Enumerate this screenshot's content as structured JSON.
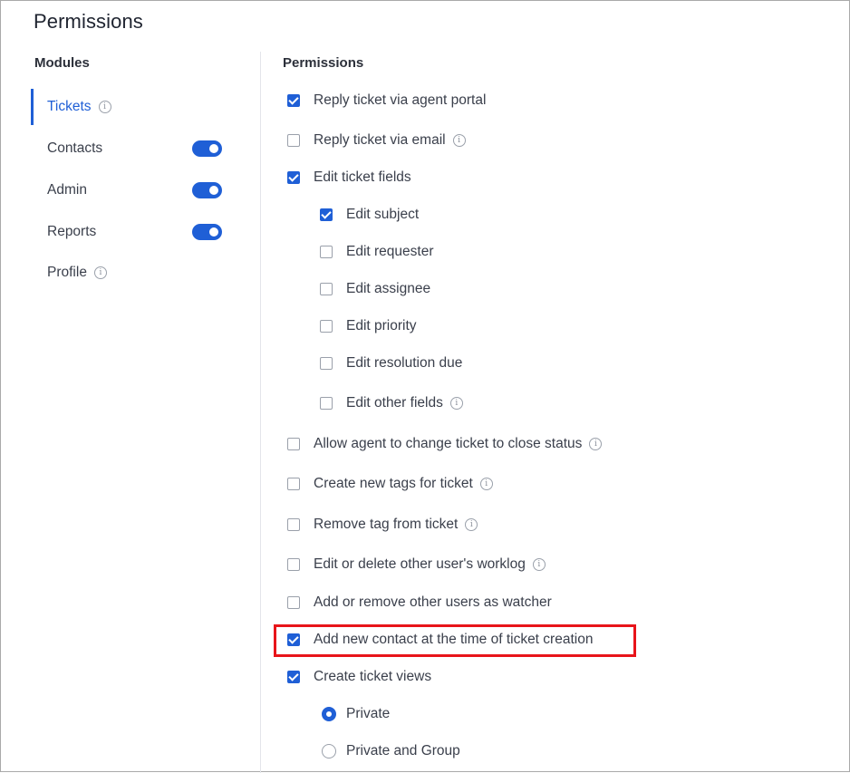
{
  "page": {
    "title": "Permissions"
  },
  "modules": {
    "heading": "Modules",
    "items": [
      {
        "label": "Tickets",
        "active": true,
        "has_info": true,
        "toggle": null
      },
      {
        "label": "Contacts",
        "active": false,
        "has_info": false,
        "toggle": "on"
      },
      {
        "label": "Admin",
        "active": false,
        "has_info": false,
        "toggle": "on"
      },
      {
        "label": "Reports",
        "active": false,
        "has_info": false,
        "toggle": "on"
      },
      {
        "label": "Profile",
        "active": false,
        "has_info": true,
        "toggle": null
      }
    ]
  },
  "permissions": {
    "heading": "Permissions",
    "items": [
      {
        "label": "Reply ticket via agent portal",
        "checked": true,
        "level": 0,
        "info": false
      },
      {
        "label": "Reply ticket via email",
        "checked": false,
        "level": 0,
        "info": true
      },
      {
        "label": "Edit ticket fields",
        "checked": true,
        "level": 0,
        "info": false
      },
      {
        "label": "Edit subject",
        "checked": true,
        "level": 1,
        "info": false
      },
      {
        "label": "Edit requester",
        "checked": false,
        "level": 1,
        "info": false
      },
      {
        "label": "Edit assignee",
        "checked": false,
        "level": 1,
        "info": false
      },
      {
        "label": "Edit priority",
        "checked": false,
        "level": 1,
        "info": false
      },
      {
        "label": "Edit resolution due",
        "checked": false,
        "level": 1,
        "info": false
      },
      {
        "label": "Edit other fields",
        "checked": false,
        "level": 1,
        "info": true
      },
      {
        "label": "Allow agent to change ticket to close status",
        "checked": false,
        "level": 0,
        "info": true
      },
      {
        "label": "Create new tags for ticket",
        "checked": false,
        "level": 0,
        "info": true
      },
      {
        "label": "Remove tag from ticket",
        "checked": false,
        "level": 0,
        "info": true
      },
      {
        "label": "Edit or delete other user's worklog",
        "checked": false,
        "level": 0,
        "info": true
      },
      {
        "label": "Add or remove other users as watcher",
        "checked": false,
        "level": 0,
        "info": false
      },
      {
        "label": "Add new contact at the time of ticket creation",
        "checked": true,
        "level": 0,
        "info": false,
        "highlighted": true
      },
      {
        "label": "Create ticket views",
        "checked": true,
        "level": 0,
        "info": false
      }
    ],
    "view_scope": [
      {
        "label": "Private",
        "selected": true
      },
      {
        "label": "Private and Group",
        "selected": false
      }
    ]
  },
  "colors": {
    "accent": "#1f5fd6",
    "highlight_border": "#e8141a",
    "text": "#3a3f4b"
  },
  "icons": {
    "info": "info-icon",
    "check": "check-icon"
  }
}
